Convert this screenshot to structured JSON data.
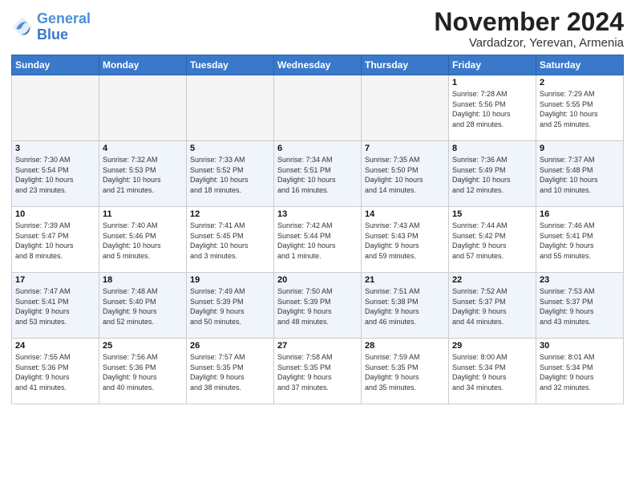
{
  "header": {
    "logo_line1": "General",
    "logo_line2": "Blue",
    "month": "November 2024",
    "location": "Vardadzor, Yerevan, Armenia"
  },
  "weekdays": [
    "Sunday",
    "Monday",
    "Tuesday",
    "Wednesday",
    "Thursday",
    "Friday",
    "Saturday"
  ],
  "weeks": [
    [
      {
        "day": "",
        "info": ""
      },
      {
        "day": "",
        "info": ""
      },
      {
        "day": "",
        "info": ""
      },
      {
        "day": "",
        "info": ""
      },
      {
        "day": "",
        "info": ""
      },
      {
        "day": "1",
        "info": "Sunrise: 7:28 AM\nSunset: 5:56 PM\nDaylight: 10 hours\nand 28 minutes."
      },
      {
        "day": "2",
        "info": "Sunrise: 7:29 AM\nSunset: 5:55 PM\nDaylight: 10 hours\nand 25 minutes."
      }
    ],
    [
      {
        "day": "3",
        "info": "Sunrise: 7:30 AM\nSunset: 5:54 PM\nDaylight: 10 hours\nand 23 minutes."
      },
      {
        "day": "4",
        "info": "Sunrise: 7:32 AM\nSunset: 5:53 PM\nDaylight: 10 hours\nand 21 minutes."
      },
      {
        "day": "5",
        "info": "Sunrise: 7:33 AM\nSunset: 5:52 PM\nDaylight: 10 hours\nand 18 minutes."
      },
      {
        "day": "6",
        "info": "Sunrise: 7:34 AM\nSunset: 5:51 PM\nDaylight: 10 hours\nand 16 minutes."
      },
      {
        "day": "7",
        "info": "Sunrise: 7:35 AM\nSunset: 5:50 PM\nDaylight: 10 hours\nand 14 minutes."
      },
      {
        "day": "8",
        "info": "Sunrise: 7:36 AM\nSunset: 5:49 PM\nDaylight: 10 hours\nand 12 minutes."
      },
      {
        "day": "9",
        "info": "Sunrise: 7:37 AM\nSunset: 5:48 PM\nDaylight: 10 hours\nand 10 minutes."
      }
    ],
    [
      {
        "day": "10",
        "info": "Sunrise: 7:39 AM\nSunset: 5:47 PM\nDaylight: 10 hours\nand 8 minutes."
      },
      {
        "day": "11",
        "info": "Sunrise: 7:40 AM\nSunset: 5:46 PM\nDaylight: 10 hours\nand 5 minutes."
      },
      {
        "day": "12",
        "info": "Sunrise: 7:41 AM\nSunset: 5:45 PM\nDaylight: 10 hours\nand 3 minutes."
      },
      {
        "day": "13",
        "info": "Sunrise: 7:42 AM\nSunset: 5:44 PM\nDaylight: 10 hours\nand 1 minute."
      },
      {
        "day": "14",
        "info": "Sunrise: 7:43 AM\nSunset: 5:43 PM\nDaylight: 9 hours\nand 59 minutes."
      },
      {
        "day": "15",
        "info": "Sunrise: 7:44 AM\nSunset: 5:42 PM\nDaylight: 9 hours\nand 57 minutes."
      },
      {
        "day": "16",
        "info": "Sunrise: 7:46 AM\nSunset: 5:41 PM\nDaylight: 9 hours\nand 55 minutes."
      }
    ],
    [
      {
        "day": "17",
        "info": "Sunrise: 7:47 AM\nSunset: 5:41 PM\nDaylight: 9 hours\nand 53 minutes."
      },
      {
        "day": "18",
        "info": "Sunrise: 7:48 AM\nSunset: 5:40 PM\nDaylight: 9 hours\nand 52 minutes."
      },
      {
        "day": "19",
        "info": "Sunrise: 7:49 AM\nSunset: 5:39 PM\nDaylight: 9 hours\nand 50 minutes."
      },
      {
        "day": "20",
        "info": "Sunrise: 7:50 AM\nSunset: 5:39 PM\nDaylight: 9 hours\nand 48 minutes."
      },
      {
        "day": "21",
        "info": "Sunrise: 7:51 AM\nSunset: 5:38 PM\nDaylight: 9 hours\nand 46 minutes."
      },
      {
        "day": "22",
        "info": "Sunrise: 7:52 AM\nSunset: 5:37 PM\nDaylight: 9 hours\nand 44 minutes."
      },
      {
        "day": "23",
        "info": "Sunrise: 7:53 AM\nSunset: 5:37 PM\nDaylight: 9 hours\nand 43 minutes."
      }
    ],
    [
      {
        "day": "24",
        "info": "Sunrise: 7:55 AM\nSunset: 5:36 PM\nDaylight: 9 hours\nand 41 minutes."
      },
      {
        "day": "25",
        "info": "Sunrise: 7:56 AM\nSunset: 5:36 PM\nDaylight: 9 hours\nand 40 minutes."
      },
      {
        "day": "26",
        "info": "Sunrise: 7:57 AM\nSunset: 5:35 PM\nDaylight: 9 hours\nand 38 minutes."
      },
      {
        "day": "27",
        "info": "Sunrise: 7:58 AM\nSunset: 5:35 PM\nDaylight: 9 hours\nand 37 minutes."
      },
      {
        "day": "28",
        "info": "Sunrise: 7:59 AM\nSunset: 5:35 PM\nDaylight: 9 hours\nand 35 minutes."
      },
      {
        "day": "29",
        "info": "Sunrise: 8:00 AM\nSunset: 5:34 PM\nDaylight: 9 hours\nand 34 minutes."
      },
      {
        "day": "30",
        "info": "Sunrise: 8:01 AM\nSunset: 5:34 PM\nDaylight: 9 hours\nand 32 minutes."
      }
    ]
  ]
}
